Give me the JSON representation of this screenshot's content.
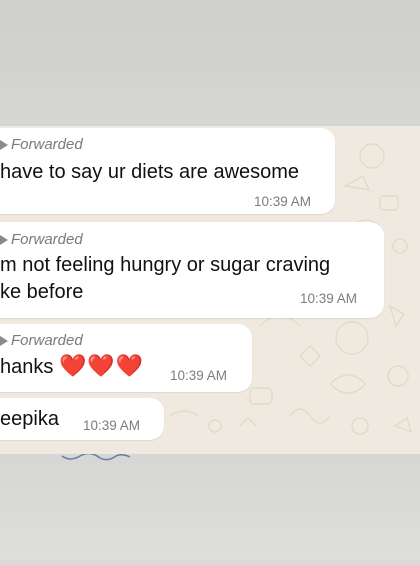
{
  "messages": [
    {
      "forwarded_label": "Forwarded",
      "text": "have to say ur diets are awesome",
      "time": "10:39 AM"
    },
    {
      "forwarded_label": "Forwarded",
      "line1": "m not feeling hungry or sugar craving",
      "line2": "ke before",
      "time": "10:39 AM"
    },
    {
      "forwarded_label": "Forwarded",
      "text": "hanks",
      "emoji": "❤️❤️❤️",
      "time": "10:39 AM"
    },
    {
      "text": "eepika",
      "time": "10:39 AM"
    }
  ],
  "colors": {
    "chat_background": "#efe9df",
    "bubble": "#ffffff",
    "timestamp": "#7c7c7c",
    "forwarded": "#7a7a7a",
    "heart": "#d62633"
  },
  "icons": {
    "forwarded": "forward-arrow-icon"
  }
}
